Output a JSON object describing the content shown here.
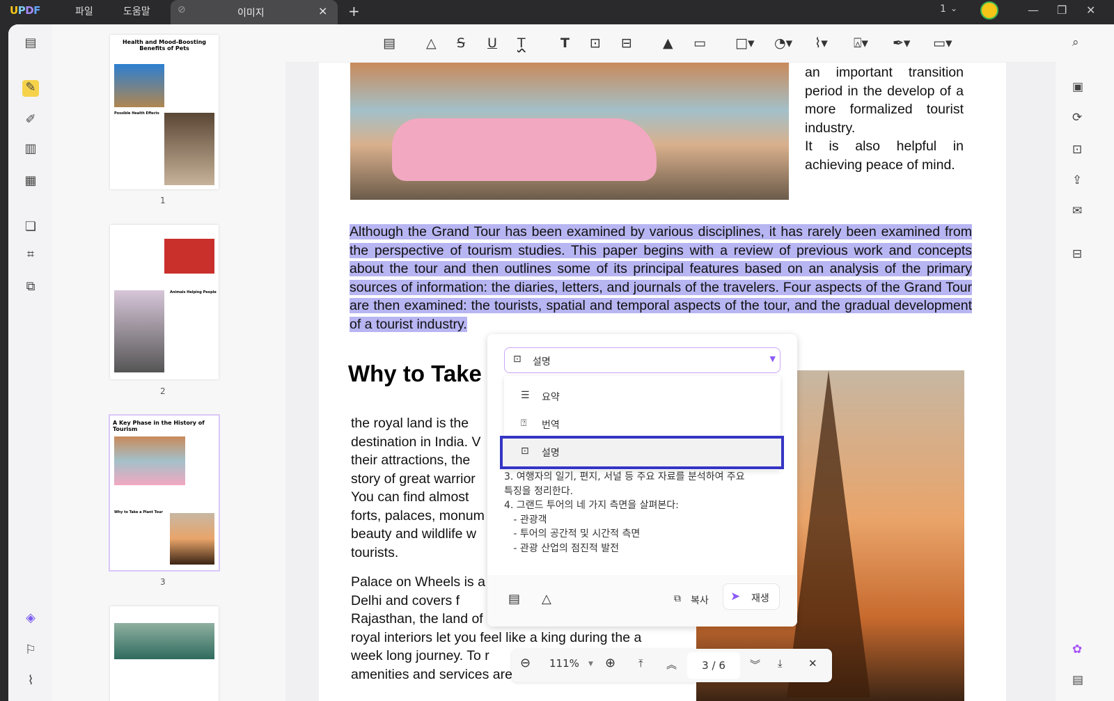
{
  "app": {
    "logo": "UPDF",
    "menu": [
      "파일",
      "도움말"
    ],
    "tab_title": "이미지",
    "tab_close": "×",
    "new_tab": "+",
    "window_count": "1",
    "window_controls": [
      "minimize",
      "restore",
      "close"
    ]
  },
  "left_rail": {
    "icons": [
      "reader-icon",
      "comment-icon",
      "edit-icon",
      "page-icon",
      "form-icon",
      "organize-icon",
      "crop-icon",
      "convert-icon",
      "layers-icon",
      "bookmark-icon",
      "attachment-icon"
    ]
  },
  "thumbnails": [
    {
      "page": "1",
      "title": "Health and Mood-Boosting Benefits of Pets",
      "subtitle": "Possible Health Effects"
    },
    {
      "page": "2",
      "title": "",
      "subtitle": "Animals Helping People"
    },
    {
      "page": "3",
      "title": "A Key Phase in the History of Tourism",
      "subtitle": "Why to Take a Plant Tour",
      "selected": true
    },
    {
      "page": "4",
      "title": "",
      "subtitle": ""
    }
  ],
  "toolbar": {
    "tools": [
      "comment",
      "highlight",
      "strikethrough",
      "underline",
      "squiggly",
      "text",
      "textbox",
      "text-callout",
      "pencil",
      "eraser",
      "shape",
      "sticker",
      "attachment",
      "stamp",
      "signature",
      "measure"
    ]
  },
  "document": {
    "side_text": "an important transition period in the develop of a more formalized tourist industry.\nIt is also helpful in achieving peace of mind.",
    "highlighted": "Although the Grand Tour has been examined by various disciplines, it has rarely been examined from the perspective of tourism studies. This paper begins with a review of previous work and concepts about the tour and then outlines some of its principal features based on an analysis of the primary sources of information: the diaries, letters, and journals of the travelers. Four aspects of the Grand Tour are then examined: the tourists, spatial and temporal aspects of the tour, and the gradual development of a tourist industry.",
    "heading": "Why to Take a",
    "para1": "the royal land is the\ndestination in India. V\ntheir attractions, the\nstory of great warrior\nYou can find almost\nforts, palaces, monum\nbeauty and wildlife w\ntourists.",
    "para2": "Palace on Wheels is a\nDelhi and covers f\nRajasthan, the land of\nroyal interiors let you feel like a king during the a\nweek long journey. To r\namenities and services are provided as per the"
  },
  "ai_panel": {
    "selected_mode": "설명",
    "options": [
      {
        "icon": "list-icon",
        "label": "요약"
      },
      {
        "icon": "translate-icon",
        "label": "번역"
      },
      {
        "icon": "explain-icon",
        "label": "설명",
        "active": true
      }
    ],
    "result": "3. 여행자의 일기, 편지, 서널 등 주요 자료를 분석하여 주요\n특징을 정리한다.\n4. 그랜드 투어의 네 가지 측면을 살펴본다:\n   - 관광객\n   - 투어의 공간적 및 시간적 측면\n   - 관광 산업의 점진적 발전",
    "copy_label": "복사",
    "regen_label": "재생",
    "accent": "#8b5cf6"
  },
  "zoom_bar": {
    "zoom": "111%",
    "current_page": "3",
    "separator": "/",
    "total_pages": "6"
  },
  "right_rail": {
    "icons": [
      "search-icon",
      "ocr-icon",
      "convert-icon",
      "protect-icon",
      "share-icon",
      "email-icon",
      "save-icon",
      "ai-assistant-icon",
      "chat-icon"
    ]
  }
}
